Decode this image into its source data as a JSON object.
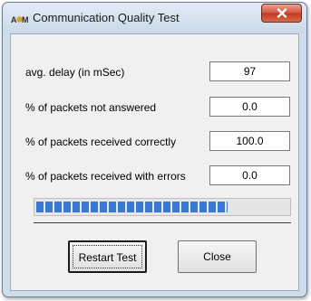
{
  "window": {
    "title": "Communication Quality Test",
    "icon": "apm-logo-icon",
    "app_icon_text": "APM"
  },
  "fields": [
    {
      "label": "avg. delay (in mSec)",
      "value": "97"
    },
    {
      "label": "% of packets not answered",
      "value": "0.0"
    },
    {
      "label": "% of packets received correctly",
      "value": "100.0"
    },
    {
      "label": "% of packets received with errors",
      "value": "0.0"
    }
  ],
  "progress": {
    "fraction": 0.76
  },
  "buttons": {
    "restart_label": "Restart Test",
    "close_label": "Close"
  },
  "colors": {
    "progress": "#3a78d6",
    "close_button": "#c8442a",
    "titlebar": "#cfdcea"
  }
}
